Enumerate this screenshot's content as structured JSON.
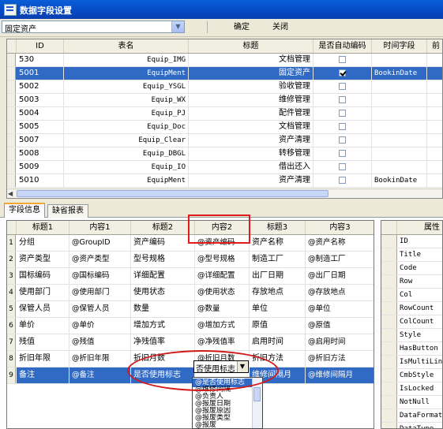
{
  "window": {
    "title": "数据字段设置"
  },
  "toolbar": {
    "combo_value": "固定资产",
    "ok_label": "确定",
    "close_label": "关闭"
  },
  "upper_grid": {
    "columns": [
      "ID",
      "表名",
      "标题",
      "是否自动编码",
      "时间字段",
      "前"
    ],
    "rows": [
      {
        "id": "530",
        "table": "Equip_IMG",
        "title": "文档管理",
        "auto": false,
        "time": ""
      },
      {
        "id": "5001",
        "table": "EquipMent",
        "title": "固定资产",
        "auto": true,
        "time": "BookinDate"
      },
      {
        "id": "5002",
        "table": "Equip_YSGL",
        "title": "验收管理",
        "auto": false,
        "time": ""
      },
      {
        "id": "5003",
        "table": "Equip_WX",
        "title": "维修管理",
        "auto": false,
        "time": ""
      },
      {
        "id": "5004",
        "table": "Equip_PJ",
        "title": "配件管理",
        "auto": false,
        "time": ""
      },
      {
        "id": "5005",
        "table": "Equip_Doc",
        "title": "文档管理",
        "auto": false,
        "time": ""
      },
      {
        "id": "5007",
        "table": "Equip_Clear",
        "title": "资产清理",
        "auto": false,
        "time": ""
      },
      {
        "id": "5008",
        "table": "Equip_DBGL",
        "title": "转移管理",
        "auto": false,
        "time": ""
      },
      {
        "id": "5009",
        "table": "Equip_IO",
        "title": "借出还入",
        "auto": false,
        "time": ""
      },
      {
        "id": "5010",
        "table": "EquipMent",
        "title": "资产清理",
        "auto": false,
        "time": "BookinDate"
      }
    ]
  },
  "tabs": [
    "字段信息",
    "缺省报表"
  ],
  "field_grid": {
    "columns": [
      "标题1",
      "内容1",
      "标题2",
      "内容2",
      "标题3",
      "内容3"
    ],
    "rows": [
      {
        "n": "1",
        "c": [
          "分组",
          "@GroupID",
          "资产编码",
          "@资产编码",
          "资产名称",
          "@资产名称"
        ]
      },
      {
        "n": "2",
        "c": [
          "资产类型",
          "@资产类型",
          "型号规格",
          "@型号规格",
          "制造工厂",
          "@制造工厂"
        ]
      },
      {
        "n": "3",
        "c": [
          "国标编码",
          "@国标编码",
          "详细配置",
          "@详细配置",
          "出厂日期",
          "@出厂日期"
        ]
      },
      {
        "n": "4",
        "c": [
          "使用部门",
          "@使用部门",
          "使用状态",
          "@使用状态",
          "存放地点",
          "@存放地点"
        ]
      },
      {
        "n": "5",
        "c": [
          "保管人员",
          "@保管人员",
          "数量",
          "@数量",
          "单位",
          "@单位"
        ]
      },
      {
        "n": "6",
        "c": [
          "单价",
          "@单价",
          "增加方式",
          "@增加方式",
          "原值",
          "@原值"
        ]
      },
      {
        "n": "7",
        "c": [
          "残值",
          "@残值",
          "净残值率",
          "@净残值率",
          "启用时间",
          "@启用时间"
        ]
      },
      {
        "n": "8",
        "c": [
          "折旧年限",
          "@折旧年限",
          "折旧月数",
          "@折旧月数",
          "折旧方法",
          "@折旧方法"
        ]
      },
      {
        "n": "9",
        "c": [
          "备注",
          "@备注",
          "是否使用标志",
          "否使用标志",
          "维修间隔月",
          "@维修间隔月"
        ]
      }
    ]
  },
  "dropdown": {
    "items": [
      "@是否使用标志",
      "@维修间隔",
      "@负责人",
      "@报废日期",
      "@报废原因",
      "@报废类型",
      "@报废"
    ]
  },
  "property_grid": {
    "header": "属性",
    "items": [
      "ID",
      "Title",
      "Code",
      "Row",
      "Col",
      "RowCount",
      "ColCount",
      "Style",
      "HasButton",
      "IsMultiLine",
      "CmbStyle",
      "IsLocked",
      "NotNull",
      "DataFormat",
      "DataType"
    ]
  }
}
